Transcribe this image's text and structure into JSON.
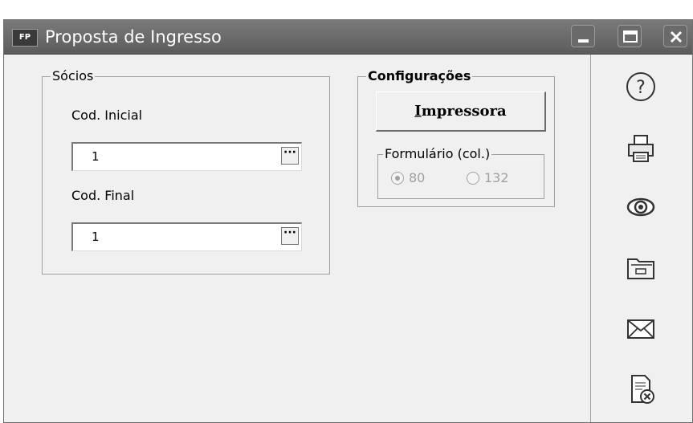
{
  "window": {
    "title": "Proposta de Ingresso",
    "app_icon_text": "FP",
    "controls": {
      "minimize": "minimize-icon",
      "maximize": "maximize-icon",
      "close": "close-icon"
    }
  },
  "socios": {
    "legend": "Sócios",
    "cod_inicial_label": "Cod. Inicial",
    "cod_inicial_value": "1",
    "cod_final_label": "Cod. Final",
    "cod_final_value": "1",
    "lookup_label": "···"
  },
  "configuracoes": {
    "legend": "Configurações",
    "impressora_label": "Impressora",
    "formulario": {
      "legend": "Formulário (col.)",
      "options": [
        "80",
        "132"
      ],
      "selected": "80"
    }
  },
  "side_actions": [
    "help-icon",
    "printer-icon",
    "preview-eye-icon",
    "folder-open-icon",
    "email-icon",
    "cancel-document-icon"
  ]
}
